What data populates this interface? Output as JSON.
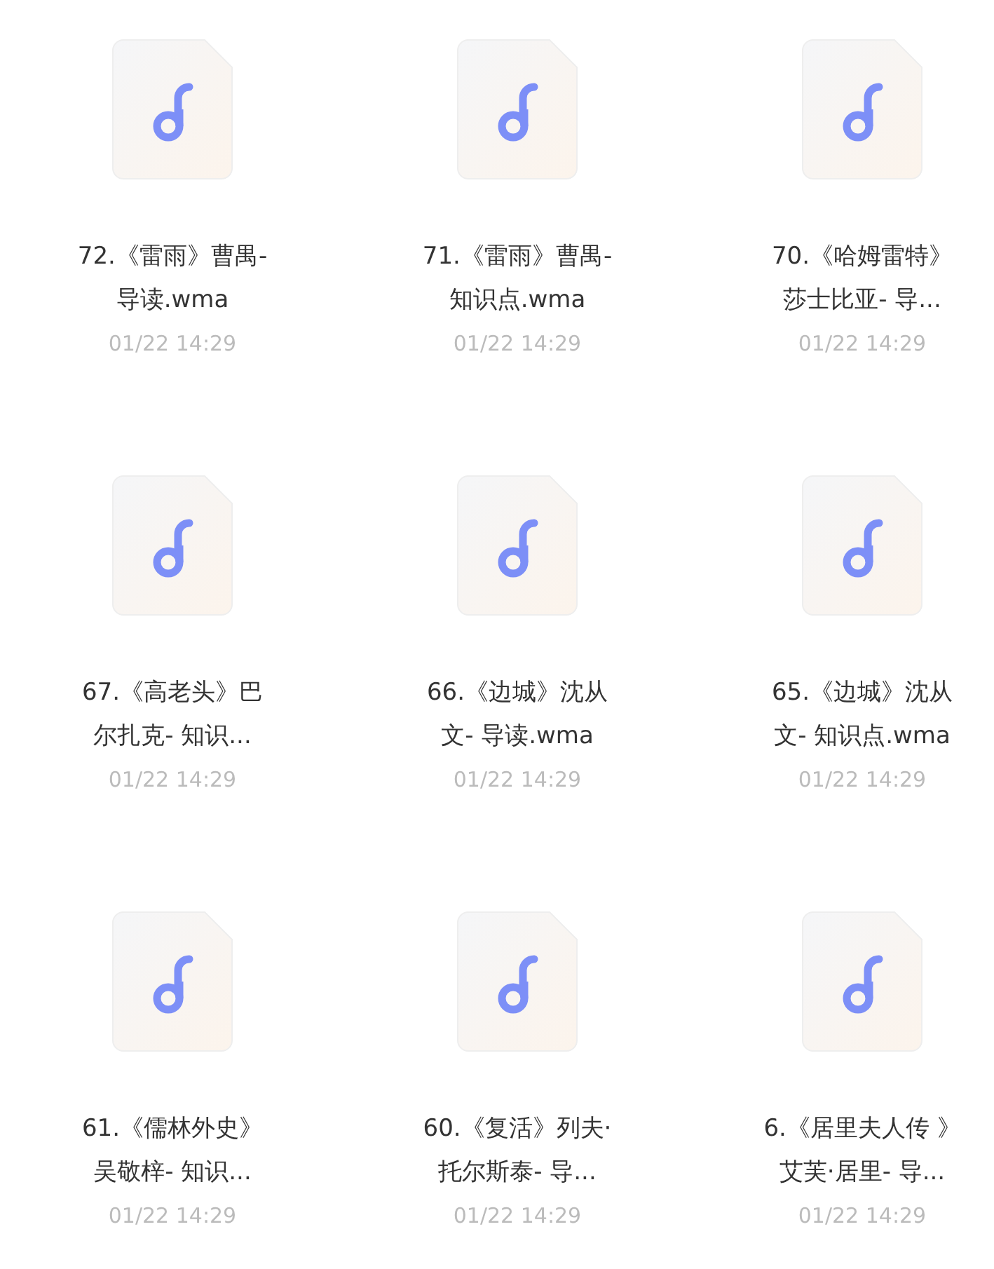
{
  "files": [
    {
      "kind": "audio",
      "name_lines": [
        "72.《雷雨》曹禺-",
        "导读.wma"
      ],
      "date": "01/22 14:29"
    },
    {
      "kind": "audio",
      "name_lines": [
        "71.《雷雨》曹禺-",
        "知识点.wma"
      ],
      "date": "01/22 14:29"
    },
    {
      "kind": "audio",
      "name_lines": [
        "70.《哈姆雷特》",
        "莎士比亚- 导..."
      ],
      "date": "01/22 14:29"
    },
    {
      "kind": "audio",
      "name_lines": [
        "67.《高老头》巴",
        "尔扎克- 知识..."
      ],
      "date": "01/22 14:29"
    },
    {
      "kind": "audio",
      "name_lines": [
        "66.《边城》沈从",
        "文- 导读.wma"
      ],
      "date": "01/22 14:29"
    },
    {
      "kind": "audio",
      "name_lines": [
        "65.《边城》沈从",
        "文- 知识点.wma"
      ],
      "date": "01/22 14:29"
    },
    {
      "kind": "audio",
      "name_lines": [
        "61.《儒林外史》",
        "吴敬梓- 知识..."
      ],
      "date": "01/22 14:29"
    },
    {
      "kind": "audio",
      "name_lines": [
        "60.《复活》列夫·",
        "托尔斯泰- 导..."
      ],
      "date": "01/22 14:29"
    },
    {
      "kind": "audio",
      "name_lines": [
        "6.《居里夫人传 》",
        "艾芙·居里- 导..."
      ],
      "date": "01/22 14:29"
    }
  ]
}
